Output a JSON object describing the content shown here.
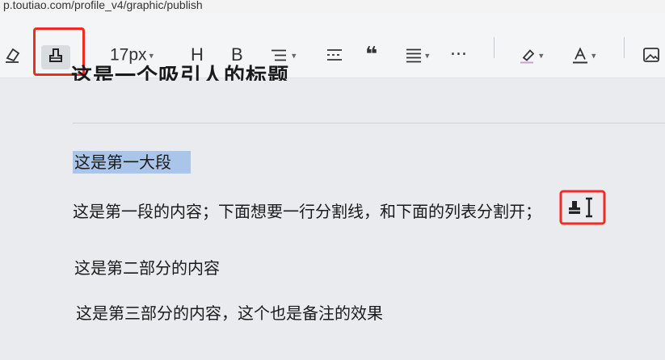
{
  "url": "p.toutiao.com/profile_v4/graphic/publish",
  "toolbar": {
    "font_size": "17px",
    "heading_label": "H",
    "bold_label": "B",
    "quote_label": "❝",
    "more_label": "···"
  },
  "editor": {
    "title": "这是一个吸引人的标题",
    "selected_text": "这是第一大段",
    "paragraphs": [
      "这是第一段的内容；下面想要一行分割线，和下面的列表分割开；",
      "这是第二部分的内容",
      "这是第三部分的内容，这个也是备注的效果"
    ]
  },
  "colors": {
    "highlight_border": "#ee2c24",
    "selection": "#a9c5ea"
  }
}
